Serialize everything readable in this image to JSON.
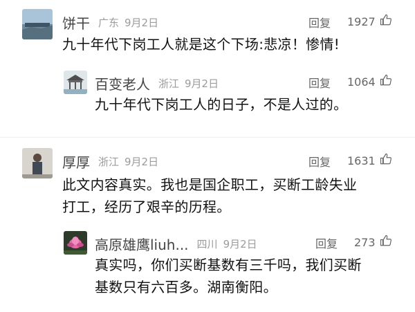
{
  "comments": [
    {
      "name": "饼干",
      "location": "广东",
      "date": "9月2日",
      "reply": "回复",
      "likes": "1927",
      "text": [
        "九十年代下岗工人就是这个下场:悲凉！惨情!"
      ]
    },
    {
      "name": "百变老人",
      "location": "浙江",
      "date": "9月2日",
      "reply": "回复",
      "likes": "1064",
      "text": [
        "九十年代下岗工人的日子，不是人过的。"
      ]
    },
    {
      "name": "厚厚",
      "location": "浙江",
      "date": "9月2日",
      "reply": "回复",
      "likes": "1631",
      "text": [
        "此文内容真实。我也是国企职工，买断工龄失业",
        "打工，经历了艰辛的历程。"
      ]
    },
    {
      "name": "高原雄鹰liuh...",
      "location": "四川",
      "date": "9月2日",
      "reply": "回复",
      "likes": "273",
      "text": [
        "真实吗，你们买断基数有三千吗，我们买断",
        "基数只有六百多。湖南衡阳。"
      ]
    }
  ],
  "icons": {
    "like": "thumbs-up-icon"
  },
  "colors": {
    "name": "#444444",
    "meta": "#9b9b9b",
    "text": "#111111"
  }
}
